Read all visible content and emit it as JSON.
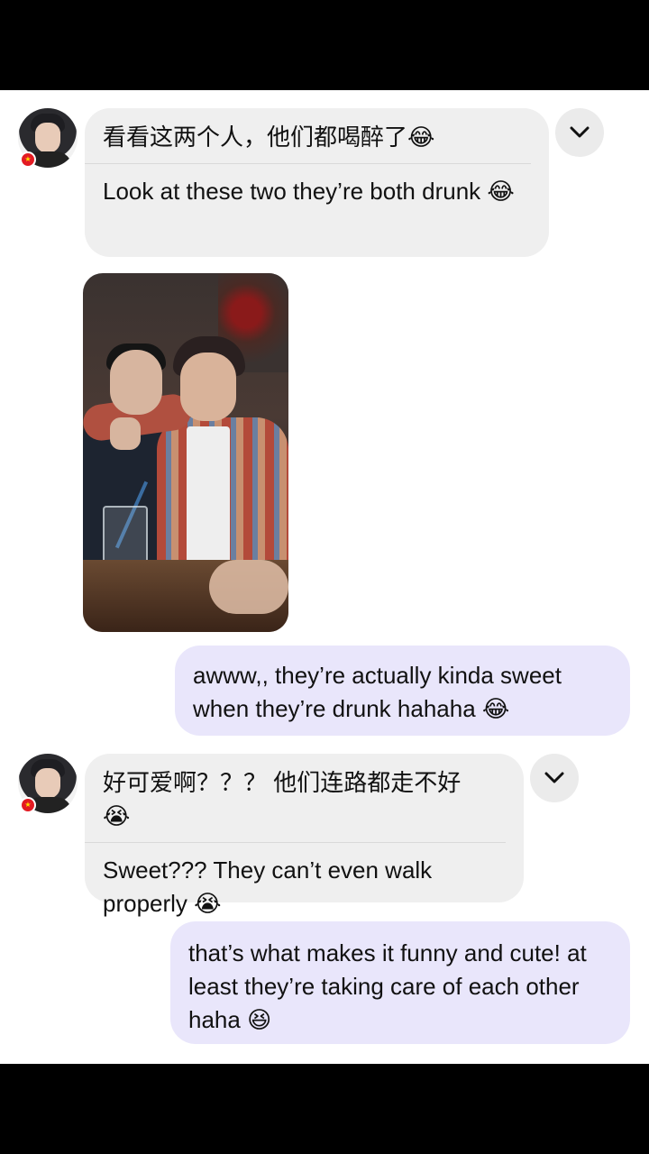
{
  "messages": [
    {
      "sender": "other",
      "zh": "看看这两个人，他们都喝醉了😂",
      "en": "Look at these two they’re both drunk 😂"
    },
    {
      "sender": "me",
      "text": "awww,, they’re actually kinda sweet when they’re drunk hahaha 😂"
    },
    {
      "sender": "other",
      "zh": "好可爱啊？？？ 他们连路都走不好😭",
      "en": "Sweet??? They can’t even walk properly 😭"
    },
    {
      "sender": "me",
      "text": "that’s what makes it funny and cute! at least they’re taking care of each other haha 😆"
    }
  ],
  "icons": {
    "dropdown": "chevron-down-icon",
    "flag": "china-flag-icon"
  },
  "colors": {
    "incoming_bubble": "#efefef",
    "outgoing_bubble": "#e9e6fb"
  }
}
